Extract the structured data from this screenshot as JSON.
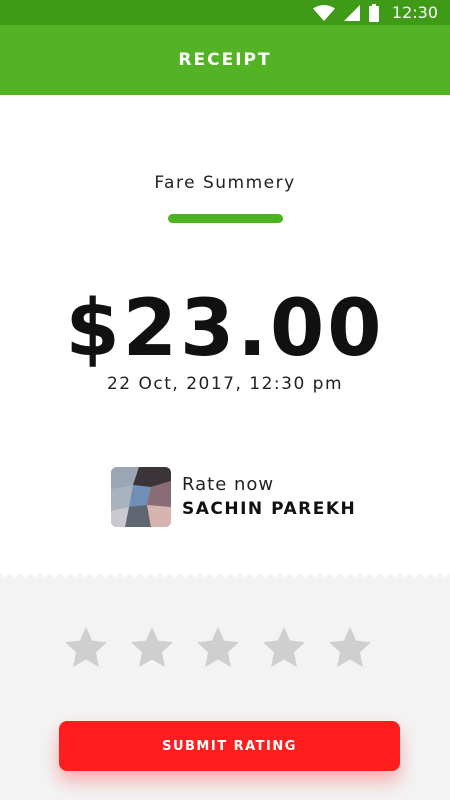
{
  "status_bar": {
    "time": "12:30",
    "icons": [
      "wifi-icon",
      "signal-icon",
      "battery-icon"
    ]
  },
  "header": {
    "title": "RECEIPT"
  },
  "receipt": {
    "fare_label": "Fare Summery",
    "amount": "$23.00",
    "date": "22 Oct, 2017, 12:30 pm"
  },
  "driver": {
    "rate_label": "Rate now",
    "name": "SACHIN PAREKH"
  },
  "rating": {
    "max_stars": 5,
    "selected": 0
  },
  "actions": {
    "submit_label": "SUBMIT RATING"
  },
  "colors": {
    "status_bar": "#3e9a17",
    "header": "#54b324",
    "accent_underline": "#4bb320",
    "star_inactive": "#cfcfcf",
    "submit_button": "#ff1d1d"
  }
}
